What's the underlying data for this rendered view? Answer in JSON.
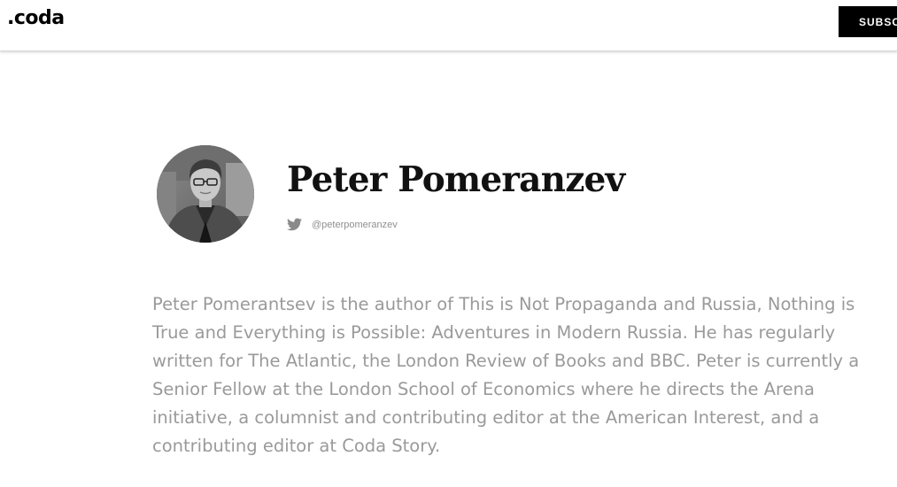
{
  "header": {
    "logo_text": ".coda",
    "subscribe_label": "SUBSCRIBE"
  },
  "author": {
    "name": "Peter Pomeranzev",
    "twitter_handle": "@peterpomeranzev",
    "bio": "Peter Pomerantsev is the author of This is Not Propaganda and Russia, Nothing is True and Everything is Possible: Adventures in Modern Russia. He has regularly written for The Atlantic, the London Review of Books and BBC. Peter is currently a Senior Fellow at the London School of Economics where he directs the Arena initiative, a columnist and contributing editor at the American Interest, and a contributing editor at Coda Story."
  },
  "icons": {
    "social": "twitter-icon"
  },
  "colors": {
    "header_bg": "#ffffff",
    "button_bg": "#000000",
    "name_color": "#111111",
    "handle_color": "#8f8f8f",
    "bio_color": "#9a9a9a"
  }
}
